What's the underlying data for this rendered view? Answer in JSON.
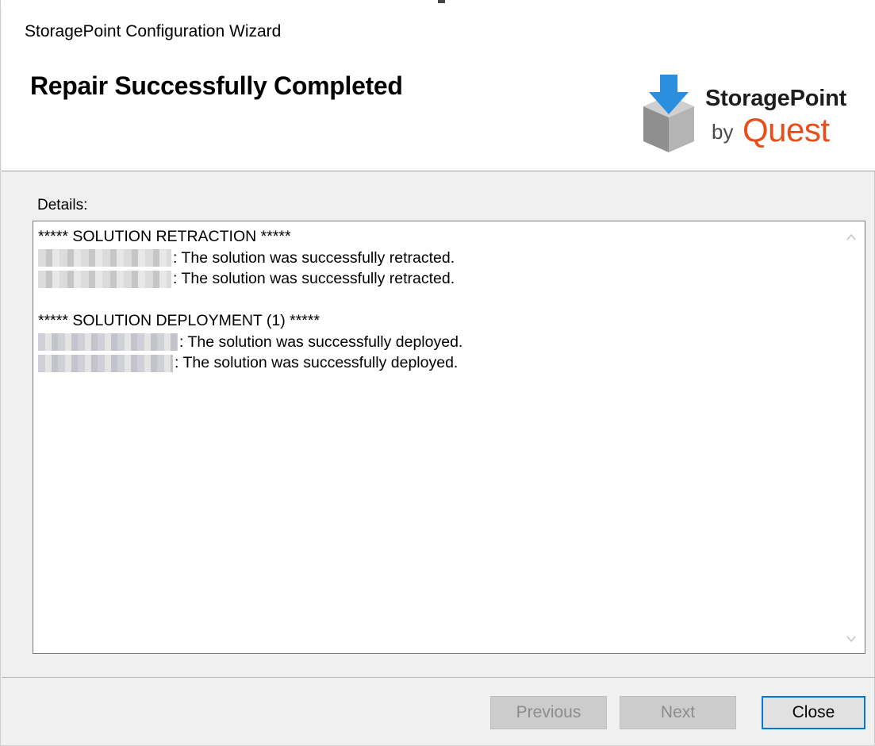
{
  "window": {
    "title": "StoragePoint Configuration Wizard"
  },
  "header": {
    "page_title": "Repair Successfully Completed",
    "logo": {
      "brand_top": "StoragePoint",
      "brand_by": "by",
      "brand_quest": "Quest",
      "colors": {
        "quest_orange": "#e84e1b",
        "arrow_blue": "#2b8fe0",
        "box_gray": "#9a9a9a"
      }
    }
  },
  "details": {
    "label": "Details:",
    "lines": [
      {
        "text": "***** SOLUTION RETRACTION *****"
      },
      {
        "text": ": The solution was successfully retracted."
      },
      {
        "text": ": The solution was successfully retracted."
      },
      {
        "text": ""
      },
      {
        "text": "***** SOLUTION DEPLOYMENT (1) *****"
      },
      {
        "text": ": The solution was successfully deployed."
      },
      {
        "text": ": The solution was successfully deployed."
      }
    ]
  },
  "footer": {
    "previous_label": "Previous",
    "next_label": "Next",
    "close_label": "Close"
  },
  "icons": {
    "scroll_up": "chevron-up-icon",
    "scroll_down": "chevron-down-icon",
    "logo": "storagepoint-box-arrow-icon"
  }
}
